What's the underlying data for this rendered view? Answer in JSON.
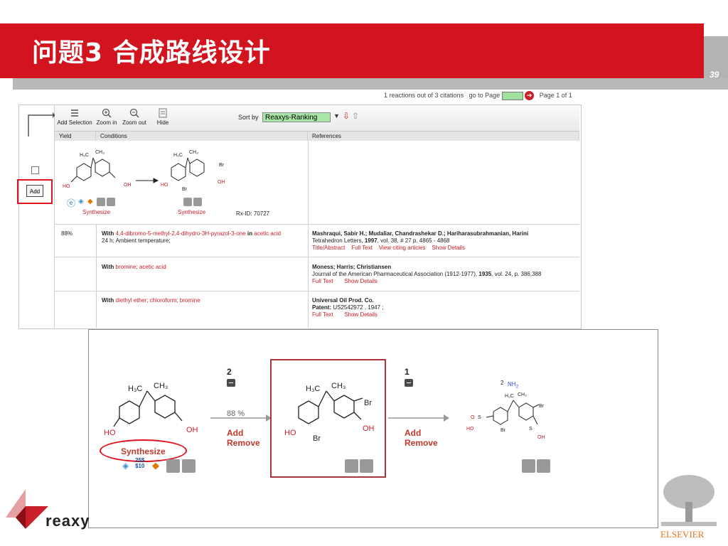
{
  "slide": {
    "title": "问题3  合成路线设计",
    "page_number": "39"
  },
  "results_header": {
    "summary": "1 reactions out of 3 citations",
    "goto_label": "go to Page",
    "page_info": "Page 1 of 1"
  },
  "toolbar": {
    "add_selection": "Add Selection",
    "zoom_in": "Zoom in",
    "zoom_out": "Zoom out",
    "hide": "Hide",
    "sort_by_label": "Sort by",
    "sort_value": "Reaxys-Ranking"
  },
  "columns": {
    "yield": "Yield",
    "conditions": "Conditions",
    "references": "References"
  },
  "reaction": {
    "add_button": "Add",
    "synthesize_left": "Synthesize",
    "synthesize_right": "Synthesize",
    "rxid": "Rx-ID: 70727"
  },
  "rows": [
    {
      "yield": "88%",
      "with_label": "With",
      "reagents": "4,4-dibromo-5-methyl-2,4-dihydro-3H-pyrazol-3-one",
      "in_label": "in",
      "solvent": "acetic acid",
      "details": "24 h; Ambient temperature;",
      "authors": "Mashraqui, Sabir H.; Mudaliar, Chandrashekar D.; Hariharasubrahmanian, Harini",
      "journal_pre": "Tetrahedron Letters,",
      "year": "1997",
      "journal_post": ", vol. 38, # 27 p. 4865 - 4868",
      "links": [
        "Title/Abstract",
        "Full Text",
        "View citing articles",
        "Show Details"
      ]
    },
    {
      "yield": "",
      "with_label": "With",
      "reagents": "bromine; acetic acid",
      "in_label": "",
      "solvent": "",
      "details": "",
      "authors": "Moness; Harris; Christiansen",
      "journal_pre": "Journal of the American Pharmaceutical Association (1912-1977),",
      "year": "1935",
      "journal_post": ", vol. 24, p. 386,388",
      "links": [
        "Full Text",
        "Show Details"
      ]
    },
    {
      "yield": "",
      "with_label": "With",
      "reagents": "diethyl ether; chloroform; bromine",
      "in_label": "",
      "solvent": "",
      "details": "",
      "authors": "Universal Oil Prod. Co.",
      "journal_pre": "Patent:",
      "year": "",
      "journal_post": "US2542972 , 1947 ;",
      "links": [
        "Full Text",
        "Show Details"
      ]
    }
  ],
  "planner": {
    "step2": "2",
    "step1": "1",
    "yield": "88 %",
    "add": "Add",
    "remove": "Remove",
    "add2": "Add",
    "remove2": "Remove",
    "synthesize": "Synthesize",
    "price_top": "25$",
    "price_bottom": "$10",
    "nh2": "NH",
    "nh2_sub": "2",
    "nh_count": "2"
  },
  "branding": {
    "reaxys": "reaxy",
    "elsevier": "ELSEVIER"
  },
  "colors": {
    "banner": "#d2141e",
    "accent_red": "#c8202a",
    "sort_green": "#a8e6a8"
  }
}
